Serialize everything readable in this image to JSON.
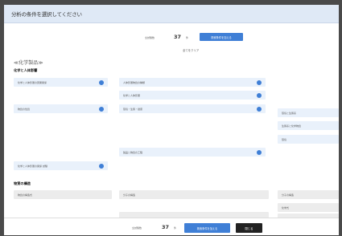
{
  "header": {
    "title": "分析の条件を選択してください"
  },
  "summary": {
    "count_label": "全試験数",
    "count_value": "37",
    "count_unit": "件",
    "search_button": "検索条件を加える",
    "clear_link": "全てをクリア"
  },
  "section": {
    "title": "≪化学製品≫"
  },
  "groups": [
    {
      "title": "化学と人体影響"
    },
    {
      "title": "物質の構造"
    }
  ],
  "options": [
    "化学と人体影響の因果関係",
    "人体影響物質の種類",
    "化学と人体影響",
    "物質の性質",
    "環境・生態・健康",
    "環境と生態系",
    "生態系と化学物質",
    "環境",
    "製品と物質の工程",
    "化学と人体影響の関係 試験",
    "物質の構造式",
    "分子の構造",
    "分子の構造",
    "化学式"
  ],
  "footer": {
    "count_label": "全試験数",
    "count_value": "37",
    "count_unit": "件",
    "search_button": "検索条件を加える",
    "close_button": "閉じる"
  },
  "colors": {
    "accent": "#3f7fd6",
    "option_bg": "#e9f1fb",
    "header_bg": "#dfe9f6"
  }
}
